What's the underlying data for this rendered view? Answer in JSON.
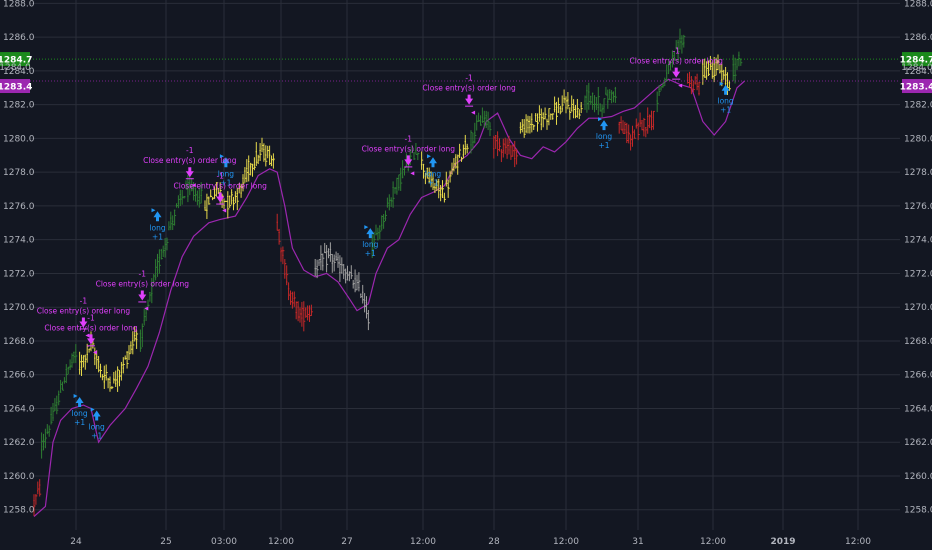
{
  "colors": {
    "background": "#131722",
    "grid": "#2a2e39",
    "axis_text": "#b2b5be",
    "bull": "#2e7d32",
    "neutral": "#e6d94a",
    "bear": "#c62828",
    "flat": "#9e9e9e",
    "trail": "#9c27b0",
    "long_signal": "#2196f3",
    "close_signal": "#e040fb",
    "price_badge": "#1b8a1b",
    "trail_badge": "#9c27b0",
    "dotted_line": "#1b8a1b"
  },
  "chart_data": {
    "type": "candlestick",
    "ylim": [
      1256.8,
      1288.2
    ],
    "grid": true,
    "y_ticks": [
      "1258.0",
      "1260.0",
      "1262.0",
      "1264.0",
      "1266.0",
      "1268.0",
      "1270.0",
      "1272.0",
      "1274.0",
      "1276.0",
      "1278.0",
      "1280.0",
      "1282.0",
      "1284.0",
      "1286.0",
      "1288.0"
    ],
    "x_ticks": [
      {
        "label": "24",
        "bold": false
      },
      {
        "label": "25",
        "bold": false
      },
      {
        "label": "03:00",
        "bold": false
      },
      {
        "label": "12:00",
        "bold": false
      },
      {
        "label": "27",
        "bold": false
      },
      {
        "label": "12:00",
        "bold": false
      },
      {
        "label": "28",
        "bold": false
      },
      {
        "label": "12:00",
        "bold": false
      },
      {
        "label": "31",
        "bold": false
      },
      {
        "label": "12:00",
        "bold": false
      },
      {
        "label": "2019",
        "bold": true
      },
      {
        "label": "12:00",
        "bold": false
      }
    ],
    "price_line": {
      "value": 1284.7,
      "label": "1284.7",
      "sublabel": "1284.0"
    },
    "trail_line": {
      "value": 1283.4,
      "label": "1283.4"
    },
    "segments": [
      {
        "color": "bear",
        "points": [
          [
            0,
            1258.4
          ],
          [
            3,
            1259.2
          ]
        ]
      },
      {
        "color": "bull",
        "points": [
          [
            4,
            1261.8
          ],
          [
            10,
            1263.5
          ],
          [
            16,
            1265.8
          ],
          [
            22,
            1267.2
          ]
        ]
      },
      {
        "color": "neutral",
        "points": [
          [
            24,
            1266.5
          ],
          [
            30,
            1267.8
          ],
          [
            36,
            1266.0
          ],
          [
            42,
            1265.5
          ],
          [
            48,
            1266.8
          ],
          [
            54,
            1268.5
          ]
        ]
      },
      {
        "color": "bull",
        "points": [
          [
            56,
            1268.0
          ],
          [
            64,
            1272.0
          ],
          [
            72,
            1275.0
          ],
          [
            80,
            1277.0
          ],
          [
            88,
            1276.5
          ]
        ]
      },
      {
        "color": "neutral",
        "points": [
          [
            90,
            1276.0
          ],
          [
            96,
            1277.0
          ],
          [
            102,
            1276.2
          ],
          [
            108,
            1276.8
          ],
          [
            114,
            1278.5
          ],
          [
            120,
            1279.2
          ],
          [
            126,
            1278.8
          ]
        ]
      },
      {
        "color": "bear",
        "points": [
          [
            128,
            1275.0
          ],
          [
            134,
            1271.0
          ],
          [
            140,
            1269.5
          ],
          [
            146,
            1269.8
          ]
        ]
      },
      {
        "color": "flat",
        "points": [
          [
            148,
            1272.5
          ],
          [
            156,
            1273.0
          ],
          [
            164,
            1272.0
          ],
          [
            172,
            1271.0
          ],
          [
            176,
            1269.5
          ]
        ]
      },
      {
        "color": "bull",
        "points": [
          [
            178,
            1273.5
          ],
          [
            186,
            1276.0
          ],
          [
            194,
            1278.0
          ],
          [
            202,
            1279.5
          ]
        ]
      },
      {
        "color": "neutral",
        "points": [
          [
            204,
            1278.5
          ],
          [
            210,
            1277.2
          ],
          [
            216,
            1276.8
          ],
          [
            222,
            1278.5
          ],
          [
            228,
            1279.8
          ]
        ]
      },
      {
        "color": "bull",
        "points": [
          [
            230,
            1280.0
          ],
          [
            236,
            1281.2
          ],
          [
            240,
            1280.8
          ]
        ]
      },
      {
        "color": "bear",
        "points": [
          [
            242,
            1279.8
          ],
          [
            248,
            1279.5
          ],
          [
            254,
            1279.2
          ]
        ]
      },
      {
        "color": "neutral",
        "points": [
          [
            256,
            1280.5
          ],
          [
            264,
            1281.0
          ],
          [
            272,
            1281.5
          ],
          [
            280,
            1282.0
          ],
          [
            288,
            1281.5
          ]
        ]
      },
      {
        "color": "bull",
        "points": [
          [
            290,
            1282.5
          ],
          [
            298,
            1282.0
          ],
          [
            306,
            1282.8
          ]
        ]
      },
      {
        "color": "bear",
        "points": [
          [
            308,
            1280.8
          ],
          [
            314,
            1280.0
          ],
          [
            320,
            1280.8
          ],
          [
            326,
            1281.2
          ]
        ]
      },
      {
        "color": "bull",
        "points": [
          [
            328,
            1282.5
          ],
          [
            336,
            1284.5
          ],
          [
            342,
            1286.0
          ]
        ]
      },
      {
        "color": "bear",
        "points": [
          [
            344,
            1283.5
          ],
          [
            350,
            1283.0
          ]
        ]
      },
      {
        "color": "neutral",
        "points": [
          [
            352,
            1284.0
          ],
          [
            360,
            1284.2
          ],
          [
            366,
            1283.0
          ]
        ]
      },
      {
        "color": "bull",
        "points": [
          [
            368,
            1284.0
          ],
          [
            372,
            1284.7
          ]
        ]
      }
    ],
    "trail": [
      [
        0,
        1257.6
      ],
      [
        6,
        1258.2
      ],
      [
        10,
        1262.0
      ],
      [
        14,
        1263.3
      ],
      [
        20,
        1264.0
      ],
      [
        26,
        1264.2
      ],
      [
        30,
        1264.0
      ],
      [
        34,
        1262.0
      ],
      [
        40,
        1263.0
      ],
      [
        48,
        1264.0
      ],
      [
        54,
        1265.2
      ],
      [
        60,
        1266.5
      ],
      [
        66,
        1268.5
      ],
      [
        72,
        1271.0
      ],
      [
        78,
        1273.0
      ],
      [
        84,
        1274.2
      ],
      [
        92,
        1275.0
      ],
      [
        98,
        1275.2
      ],
      [
        106,
        1275.4
      ],
      [
        112,
        1276.5
      ],
      [
        118,
        1277.8
      ],
      [
        124,
        1278.2
      ],
      [
        128,
        1278.0
      ],
      [
        132,
        1276.0
      ],
      [
        136,
        1273.5
      ],
      [
        142,
        1272.2
      ],
      [
        148,
        1271.8
      ],
      [
        154,
        1272.0
      ],
      [
        160,
        1271.5
      ],
      [
        166,
        1270.5
      ],
      [
        170,
        1269.8
      ],
      [
        176,
        1270.2
      ],
      [
        180,
        1272.0
      ],
      [
        186,
        1273.5
      ],
      [
        192,
        1274.0
      ],
      [
        198,
        1275.5
      ],
      [
        204,
        1276.5
      ],
      [
        210,
        1276.8
      ],
      [
        216,
        1277.2
      ],
      [
        222,
        1278.5
      ],
      [
        228,
        1279.0
      ],
      [
        234,
        1279.8
      ],
      [
        238,
        1281.0
      ],
      [
        244,
        1281.5
      ],
      [
        250,
        1280.0
      ],
      [
        256,
        1279.0
      ],
      [
        262,
        1278.8
      ],
      [
        268,
        1279.5
      ],
      [
        274,
        1279.2
      ],
      [
        280,
        1279.8
      ],
      [
        286,
        1280.6
      ],
      [
        292,
        1281.2
      ],
      [
        298,
        1281.2
      ],
      [
        304,
        1281.3
      ],
      [
        310,
        1281.6
      ],
      [
        316,
        1281.8
      ],
      [
        322,
        1282.4
      ],
      [
        328,
        1283.0
      ],
      [
        334,
        1283.5
      ],
      [
        340,
        1283.2
      ],
      [
        346,
        1283.0
      ],
      [
        352,
        1281.0
      ],
      [
        358,
        1280.2
      ],
      [
        364,
        1281.0
      ],
      [
        370,
        1283.0
      ],
      [
        374,
        1283.4
      ]
    ],
    "annotations": [
      {
        "type": "long",
        "i": 24,
        "price": 1264.8,
        "label": "long",
        "qty": "+1"
      },
      {
        "type": "long",
        "i": 33,
        "price": 1264.0,
        "label": "long",
        "qty": "+1"
      },
      {
        "type": "long",
        "i": 65,
        "price": 1275.8,
        "label": "long",
        "qty": "+1"
      },
      {
        "type": "long",
        "i": 101,
        "price": 1279.0,
        "label": "long",
        "qty": "+1"
      },
      {
        "type": "long",
        "i": 177,
        "price": 1274.8,
        "label": "long",
        "qty": "+1"
      },
      {
        "type": "long",
        "i": 210,
        "price": 1279.0,
        "label": "long",
        "qty": "+1"
      },
      {
        "type": "long",
        "i": 300,
        "price": 1281.2,
        "label": "long",
        "qty": "+1"
      },
      {
        "type": "long",
        "i": 364,
        "price": 1283.3,
        "label": "long",
        "qty": "+1"
      },
      {
        "type": "close",
        "i": 26,
        "price": 1268.8,
        "label": "Close entry(s) order long",
        "qty": "-1"
      },
      {
        "type": "close",
        "i": 30,
        "price": 1267.8,
        "label": "Close entry(s) order long",
        "qty": "-1"
      },
      {
        "type": "close",
        "i": 57,
        "price": 1270.4,
        "label": "Close entry(s) order long",
        "qty": "-1"
      },
      {
        "type": "close",
        "i": 82,
        "price": 1277.7,
        "label": "Close entry(s) order long",
        "qty": "-1"
      },
      {
        "type": "close",
        "i": 98,
        "price": 1276.2,
        "label": "Close entry(s) order long",
        "qty": "-1"
      },
      {
        "type": "close",
        "i": 197,
        "price": 1278.4,
        "label": "Close entry(s) order long",
        "qty": "-1"
      },
      {
        "type": "close",
        "i": 229,
        "price": 1282.0,
        "label": "Close entry(s) order long",
        "qty": "-1"
      },
      {
        "type": "close",
        "i": 338,
        "price": 1283.6,
        "label": "Close entry(s) order long",
        "qty": "-1"
      }
    ]
  }
}
